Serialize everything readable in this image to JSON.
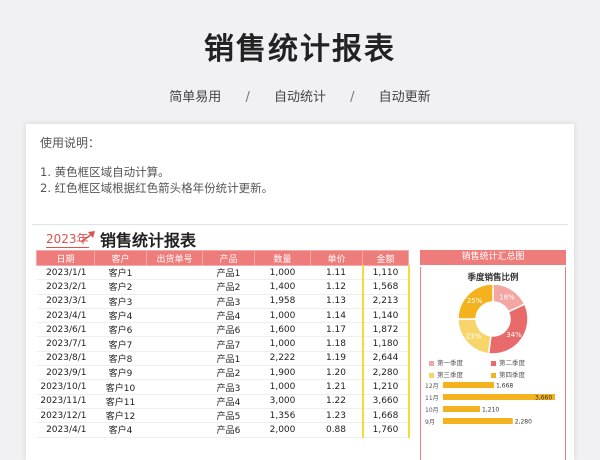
{
  "hero": {
    "title": "销售统计报表"
  },
  "tagline": {
    "a": "简单易用",
    "b": "自动统计",
    "c": "自动更新",
    "sep": "/"
  },
  "instructions": {
    "title": "使用说明：",
    "line1": "1. 黄色框区域自动计算。",
    "line2": "2. 红色框区域根据红色箭头格年份统计更新。"
  },
  "report": {
    "year": "2023年",
    "title": "销售统计报表"
  },
  "table": {
    "headers": [
      "日期",
      "客户",
      "出货单号",
      "产品",
      "数量",
      "单价",
      "金额"
    ],
    "rows": [
      [
        "2023/1/1",
        "客户1",
        "",
        "产品1",
        "1,000",
        "1.11",
        "1,110"
      ],
      [
        "2023/2/1",
        "客户2",
        "",
        "产品2",
        "1,400",
        "1.12",
        "1,568"
      ],
      [
        "2023/3/1",
        "客户3",
        "",
        "产品3",
        "1,958",
        "1.13",
        "2,213"
      ],
      [
        "2023/4/1",
        "客户4",
        "",
        "产品4",
        "1,000",
        "1.14",
        "1,140"
      ],
      [
        "2023/6/1",
        "客户6",
        "",
        "产品6",
        "1,600",
        "1.17",
        "1,872"
      ],
      [
        "2023/7/1",
        "客户7",
        "",
        "产品7",
        "1,000",
        "1.18",
        "1,180"
      ],
      [
        "2023/8/1",
        "客户8",
        "",
        "产品1",
        "2,222",
        "1.19",
        "2,644"
      ],
      [
        "2023/9/1",
        "客户9",
        "",
        "产品2",
        "1,900",
        "1.20",
        "2,280"
      ],
      [
        "2023/10/1",
        "客户10",
        "",
        "产品3",
        "1,000",
        "1.21",
        "1,210"
      ],
      [
        "2023/11/1",
        "客户11",
        "",
        "产品4",
        "3,000",
        "1.22",
        "3,660"
      ],
      [
        "2023/12/1",
        "客户12",
        "",
        "产品5",
        "1,356",
        "1.23",
        "1,668"
      ],
      [
        "2023/4/1",
        "客户4",
        "",
        "产品6",
        "2,000",
        "0.88",
        "1,760"
      ]
    ]
  },
  "panel": {
    "title": "销售统计汇总图",
    "subtitle": "季度销售比例"
  },
  "colors": {
    "q1": "#f4a6a3",
    "q2": "#e86a6a",
    "q3": "#f7d56b",
    "q4": "#f3b21e",
    "bar": "#f3b21e"
  },
  "chart_data": [
    {
      "type": "pie",
      "title": "季度销售比例",
      "categories": [
        "第一季度",
        "第二季度",
        "第三季度",
        "第四季度"
      ],
      "values": [
        18,
        34,
        23,
        25
      ],
      "labels": [
        "18%",
        "34%",
        "23%",
        "25%"
      ]
    },
    {
      "type": "bar",
      "categories": [
        "12月",
        "11月",
        "10月",
        "9月"
      ],
      "values": [
        1668,
        3660,
        1210,
        2280
      ],
      "labels": [
        "1,668",
        "3,660",
        "1,210",
        "2,280"
      ]
    }
  ]
}
